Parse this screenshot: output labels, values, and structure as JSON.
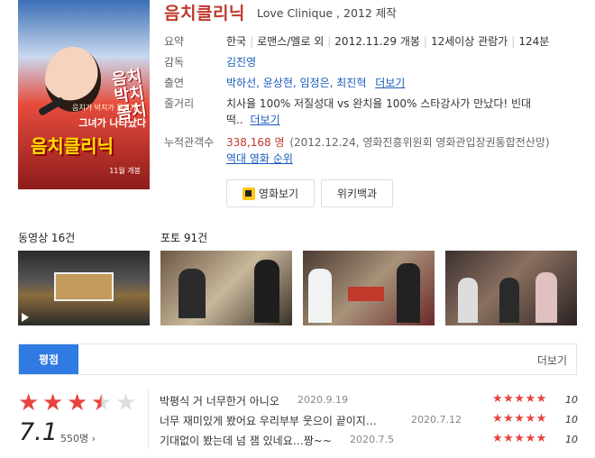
{
  "movie": {
    "title": "음치클리닉",
    "subtitle": "Love Clinique , 2012 제작",
    "poster": {
      "line1": "음치\n박치\n몸치",
      "line2": "그녀가 나타났다",
      "line3": "음치클리닉",
      "line4": "음치가 박치가 몸치가",
      "line5": "11월 개봉"
    }
  },
  "info": {
    "summary_label": "요약",
    "summary": [
      "한국",
      "로맨스/멜로 외",
      "2012.11.29 개봉",
      "12세이상 관람가",
      "124분"
    ],
    "director_label": "감독",
    "director": "김진영",
    "cast_label": "출연",
    "cast": "박하선, 윤상현, 임정은, 최진혁",
    "more_label": "더보기",
    "synopsis_label": "줄거리",
    "synopsis_line1": "치사율 100% 저질성대 vs 완치율 100% 스타강사가 만났다! 빈대",
    "synopsis_line2": "떡..",
    "audience_label": "누적관객수",
    "audience_count": "338,168 명",
    "audience_note": "(2012.12.24, 영화진흥위원회 영화관입장권통합전산망)",
    "ranking_link": "역대 영화 순위"
  },
  "buttons": {
    "watch": "영화보기",
    "wiki": "위키백과"
  },
  "media": {
    "video_label": "동영상 16건",
    "photo_label": "포토 91건"
  },
  "rating": {
    "tab": "평점",
    "more": "더보기",
    "score": "7.1",
    "count": "550명 ›",
    "stars_filled": 3.5,
    "reviews": [
      {
        "text": "박평식 거 너무한거 아니오",
        "date": "2020.9.19",
        "score": "10"
      },
      {
        "text": "너무 재미있게 봤어요 우리부부 웃으이 끝이지…",
        "date": "2020.7.12",
        "score": "10"
      },
      {
        "text": "기대없이 봤는데 넘 잼 있네요…짱~~",
        "date": "2020.7.5",
        "score": "10"
      }
    ]
  },
  "colors": {
    "accent": "#2f7be3",
    "title": "#c0392b",
    "star": "#e8443e",
    "link": "#1a5bbd"
  }
}
